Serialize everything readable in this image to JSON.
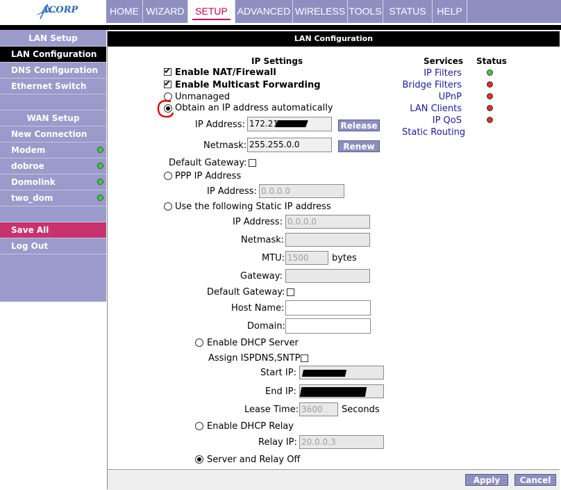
{
  "brand": {
    "logo_text": "ACORP"
  },
  "topnav": {
    "tabs": [
      {
        "label": "HOME"
      },
      {
        "label": "WIZARD"
      },
      {
        "label": "SETUP"
      },
      {
        "label": "ADVANCED"
      },
      {
        "label": "WIRELESS"
      },
      {
        "label": "TOOLS"
      },
      {
        "label": "STATUS"
      },
      {
        "label": "HELP"
      }
    ],
    "active": "SETUP"
  },
  "sidebar": {
    "lan_header": "LAN Setup",
    "lan_items": [
      {
        "label": "LAN Configuration"
      },
      {
        "label": "DNS Configuration"
      },
      {
        "label": "Ethernet Switch"
      }
    ],
    "wan_header": "WAN Setup",
    "wan_items": [
      {
        "label": "New Connection"
      },
      {
        "label": "Modem",
        "status": "green"
      },
      {
        "label": "dobroe",
        "status": "green"
      },
      {
        "label": "Domolink",
        "status": "green"
      },
      {
        "label": "two_dom",
        "status": "green"
      }
    ],
    "save_all": "Save All",
    "log_out": "Log Out"
  },
  "main": {
    "header": "LAN Configuration",
    "ip_settings_title": "IP Settings",
    "enable_nat": "Enable NAT/Firewall",
    "enable_multicast": "Enable Multicast Forwarding",
    "unmanaged": "Unmanaged",
    "obtain_auto": "Obtain an IP address automatically",
    "auto_ip_label": "IP Address:",
    "auto_ip_value": "172.21.",
    "release": "Release",
    "auto_netmask_label": "Netmask:",
    "auto_netmask_value": "255.255.0.0",
    "renew": "Renew",
    "default_gateway_label": "Default Gateway:",
    "ppp_ip": "PPP IP Address",
    "ppp_ip_label": "IP Address:",
    "ppp_ip_value": "0.0.0.0",
    "static_ip": "Use the following Static IP address",
    "static_ip_label": "IP Address:",
    "static_ip_value": "0.0.0.0",
    "static_netmask_label": "Netmask:",
    "static_netmask_value": "",
    "mtu_label": "MTU:",
    "mtu_value": "1500",
    "mtu_unit": "bytes",
    "gateway_label": "Gateway:",
    "gateway_value": "",
    "static_default_gateway_label": "Default Gateway:",
    "host_name_label": "Host Name:",
    "host_name_value": "",
    "domain_label": "Domain:",
    "domain_value": "",
    "enable_dhcp_server": "Enable DHCP Server",
    "assign_ispdns": "Assign ISPDNS,SNTP",
    "start_ip_label": "Start IP:",
    "end_ip_label": "End IP:",
    "lease_time_label": "Lease Time:",
    "lease_time_value": "3600",
    "lease_time_unit": "Seconds",
    "enable_dhcp_relay": "Enable DHCP Relay",
    "relay_ip_label": "Relay IP:",
    "relay_ip_value": "20.0.0.3",
    "server_relay_off": "Server and Relay Off"
  },
  "services": {
    "services_header": "Services",
    "status_header": "Status",
    "items": [
      {
        "label": "IP Filters",
        "status": "green",
        "color": "#44c744"
      },
      {
        "label": "Bridge Filters",
        "status": "red",
        "color": "#e03020"
      },
      {
        "label": "UPnP",
        "status": "red",
        "color": "#e03020"
      },
      {
        "label": "LAN Clients",
        "status": "red",
        "color": "#e03020"
      },
      {
        "label": "IP QoS",
        "status": "red",
        "color": "#e03020"
      }
    ],
    "static_routing": "Static Routing"
  },
  "footer": {
    "apply": "Apply",
    "cancel": "Cancel"
  },
  "colors": {
    "nav_bg": "#8e8ec0",
    "sidebar_bg": "#9a9acb",
    "active_tab_text": "#c9005a",
    "save_all_bg": "#c8336d",
    "link": "#1a1aa0"
  }
}
